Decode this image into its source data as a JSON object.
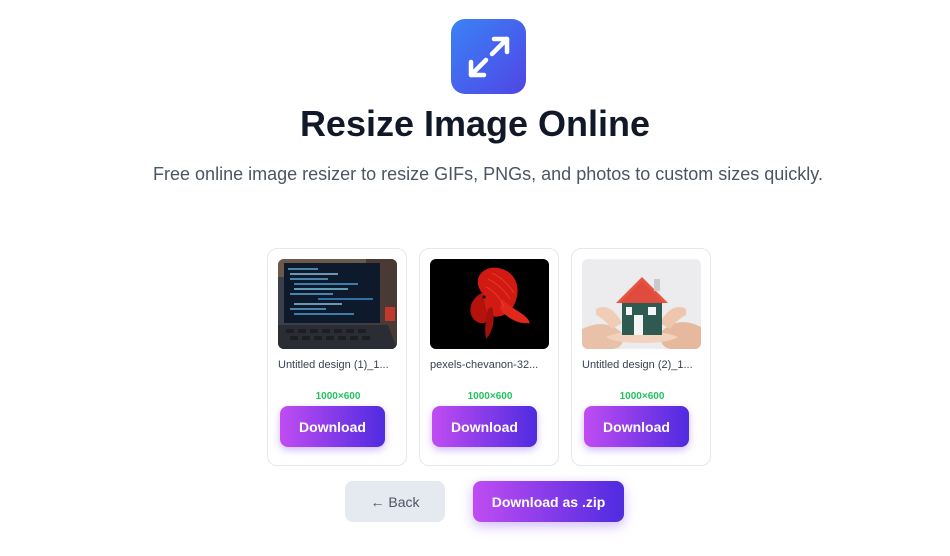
{
  "header": {
    "icon": "resize-arrows-icon",
    "title": "Resize Image Online",
    "subtitle": "Free online image resizer to resize GIFs, PNGs, and photos to custom sizes quickly."
  },
  "results": [
    {
      "thumbnail": "laptop-code-photo",
      "filename": "Untitled design (1)_1...",
      "dimensions": "1000×600",
      "download_label": "Download"
    },
    {
      "thumbnail": "red-betta-fish-photo",
      "filename": "pexels-chevanon-32...",
      "dimensions": "1000×600",
      "download_label": "Download"
    },
    {
      "thumbnail": "hands-holding-house-photo",
      "filename": "Untitled design (2)_1...",
      "dimensions": "1000×600",
      "download_label": "Download"
    }
  ],
  "actions": {
    "back_label": "← Back",
    "zip_label": "Download as .zip"
  },
  "colors": {
    "accent_start": "#c04cf2",
    "accent_end": "#4f2be0",
    "dimension_text": "#22c55e"
  }
}
